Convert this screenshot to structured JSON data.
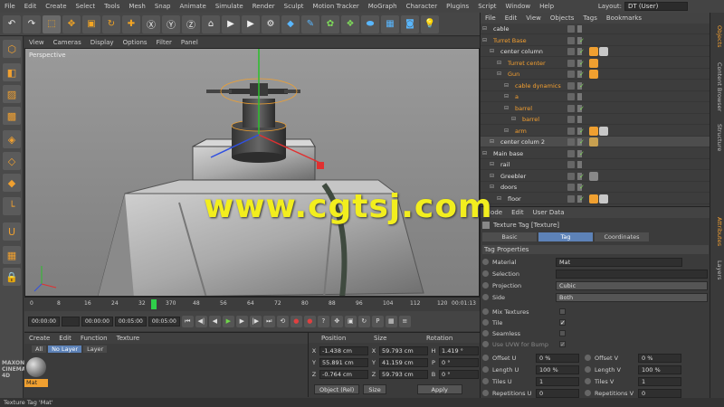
{
  "menubar": {
    "items": [
      "File",
      "Edit",
      "Create",
      "Select",
      "Tools",
      "Mesh",
      "Snap",
      "Animate",
      "Simulate",
      "Render",
      "Sculpt",
      "Motion Tracker",
      "MoGraph",
      "Character",
      "Plugins",
      "Script",
      "Window",
      "Help"
    ],
    "layout_label": "Layout:",
    "layout_value": "DT (User)"
  },
  "viewport": {
    "menu": [
      "View",
      "Cameras",
      "Display",
      "Options",
      "Filter",
      "Panel"
    ],
    "label": "Perspective"
  },
  "timeline": {
    "ticks": [
      "0",
      "8",
      "16",
      "24",
      "32",
      "370",
      "48",
      "56",
      "64",
      "72",
      "80",
      "88",
      "96",
      "104",
      "112",
      "120"
    ],
    "frame": "0 F",
    "frame_right": "00:01:13"
  },
  "playbar": {
    "start": "00:00:00",
    "current": "00:00:00",
    "end_preview": "00:05:00",
    "end": "00:05:00"
  },
  "material_manager": {
    "menu": [
      "Create",
      "Edit",
      "Function",
      "Texture"
    ],
    "tabs": [
      "All",
      "No Layer",
      "Layer"
    ],
    "material_name": "Mat"
  },
  "brand": {
    "line1": "MAXON",
    "line2": "CINEMA 4D"
  },
  "coordinates": {
    "headers": [
      "Position",
      "Size",
      "Rotation"
    ],
    "rows": [
      {
        "axis": "X",
        "pos": "-1.438 cm",
        "size": "59.793 cm",
        "rot_axis": "H",
        "rot": "1.419 °"
      },
      {
        "axis": "Y",
        "pos": "55.891 cm",
        "size": "41.159 cm",
        "rot_axis": "P",
        "rot": "0 °"
      },
      {
        "axis": "Z",
        "pos": "-0.764 cm",
        "size": "59.793 cm",
        "rot_axis": "B",
        "rot": "0 °"
      }
    ],
    "mode": "Object (Rel)",
    "size_mode": "Size",
    "apply": "Apply"
  },
  "status": "Texture Tag 'Mat'",
  "objects": {
    "menu": [
      "File",
      "Edit",
      "View",
      "Objects",
      "Tags",
      "Bookmarks"
    ],
    "rows": [
      {
        "name": "cable",
        "indent": 10,
        "color": "white"
      },
      {
        "name": "Turret Base",
        "indent": 10,
        "color": "orange"
      },
      {
        "name": "center column",
        "indent": 18,
        "color": "white"
      },
      {
        "name": "Turret center",
        "indent": 26,
        "color": "orange"
      },
      {
        "name": "Gun",
        "indent": 26,
        "color": "orange"
      },
      {
        "name": "cable dynamics",
        "indent": 34,
        "color": "orange"
      },
      {
        "name": "a",
        "indent": 34,
        "color": "orange"
      },
      {
        "name": "barrel",
        "indent": 34,
        "color": "orange"
      },
      {
        "name": "barrel",
        "indent": 42,
        "color": "orange"
      },
      {
        "name": "arm",
        "indent": 34,
        "color": "orange"
      },
      {
        "name": "center colum 2",
        "indent": 18,
        "color": "white"
      },
      {
        "name": "Main base",
        "indent": 10,
        "color": "white"
      },
      {
        "name": "rail",
        "indent": 18,
        "color": "white"
      },
      {
        "name": "Greebler",
        "indent": 18,
        "color": "white"
      },
      {
        "name": "doors",
        "indent": 18,
        "color": "white"
      },
      {
        "name": "floor",
        "indent": 26,
        "color": "white"
      }
    ]
  },
  "attributes": {
    "menu": [
      "Mode",
      "Edit",
      "User Data"
    ],
    "title": "Texture Tag [Texture]",
    "tabs": [
      "Basic",
      "Tag",
      "Coordinates"
    ],
    "section": "Tag Properties",
    "material_label": "Material",
    "material": "Mat",
    "selection_label": "Selection",
    "projection_label": "Projection",
    "projection": "Cubic",
    "side_label": "Side",
    "side": "Both",
    "mix_label": "Mix Textures",
    "tile_label": "Tile",
    "seamless_label": "Seamless",
    "uvw_label": "Use UVW for Bump",
    "offset_u_label": "Offset U",
    "offset_u": "0 %",
    "offset_v_label": "Offset V",
    "offset_v": "0 %",
    "length_u_label": "Length U",
    "length_u": "100 %",
    "length_v_label": "Length V",
    "length_v": "100 %",
    "tiles_u_label": "Tiles U",
    "tiles_u": "1",
    "tiles_v_label": "Tiles V",
    "tiles_v": "1",
    "rep_u_label": "Repetitions U",
    "rep_u": "0",
    "rep_v_label": "Repetitions V",
    "rep_v": "0"
  },
  "sidetabs": [
    "Objects",
    "Content Browser",
    "Structure",
    "Attributes",
    "Layers"
  ],
  "watermark": "www.cgtsj.com"
}
